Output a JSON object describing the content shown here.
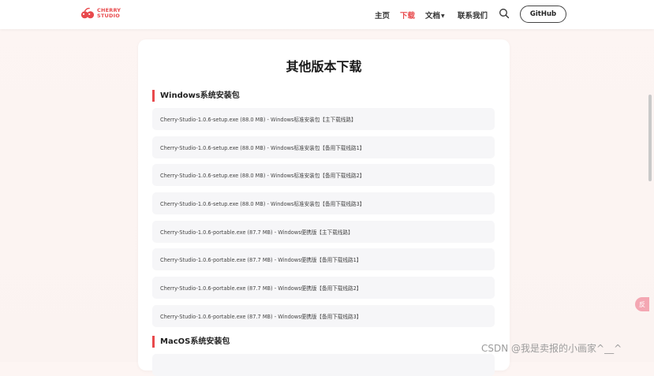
{
  "header": {
    "logo": {
      "line1": "CHERRY",
      "line2": "STUDIO"
    },
    "nav": [
      {
        "label": "主页",
        "active": false
      },
      {
        "label": "下载",
        "active": true
      },
      {
        "label": "文档",
        "active": false,
        "has_dropdown": true
      },
      {
        "label": "联系我们",
        "active": false
      }
    ],
    "github_label": "GitHub"
  },
  "page_title": "其他版本下载",
  "sections": [
    {
      "title": "Windows系统安装包",
      "items": [
        "Cherry-Studio-1.0.6-setup.exe (88.0 MB) - Windows标准安装包【主下载线路】",
        "Cherry-Studio-1.0.6-setup.exe (88.0 MB) - Windows标准安装包【备用下载线路1】",
        "Cherry-Studio-1.0.6-setup.exe (88.0 MB) - Windows标准安装包【备用下载线路2】",
        "Cherry-Studio-1.0.6-setup.exe (88.0 MB) - Windows标准安装包【备用下载线路3】",
        "Cherry-Studio-1.0.6-portable.exe (87.7 MB) - Windows便携版【主下载线路】",
        "Cherry-Studio-1.0.6-portable.exe (87.7 MB) - Windows便携版【备用下载线路1】",
        "Cherry-Studio-1.0.6-portable.exe (87.7 MB) - Windows便携版【备用下载线路2】",
        "Cherry-Studio-1.0.6-portable.exe (87.7 MB) - Windows便携版【备用下载线路3】"
      ]
    },
    {
      "title": "MacOS系统安装包",
      "items": []
    }
  ],
  "float_button_label": "反",
  "watermark": "CSDN @我是卖报的小画家^__^",
  "colors": {
    "accent": "#e8494c",
    "item_bg": "#f6f6f8",
    "page_bg": "#fdf5f3"
  }
}
